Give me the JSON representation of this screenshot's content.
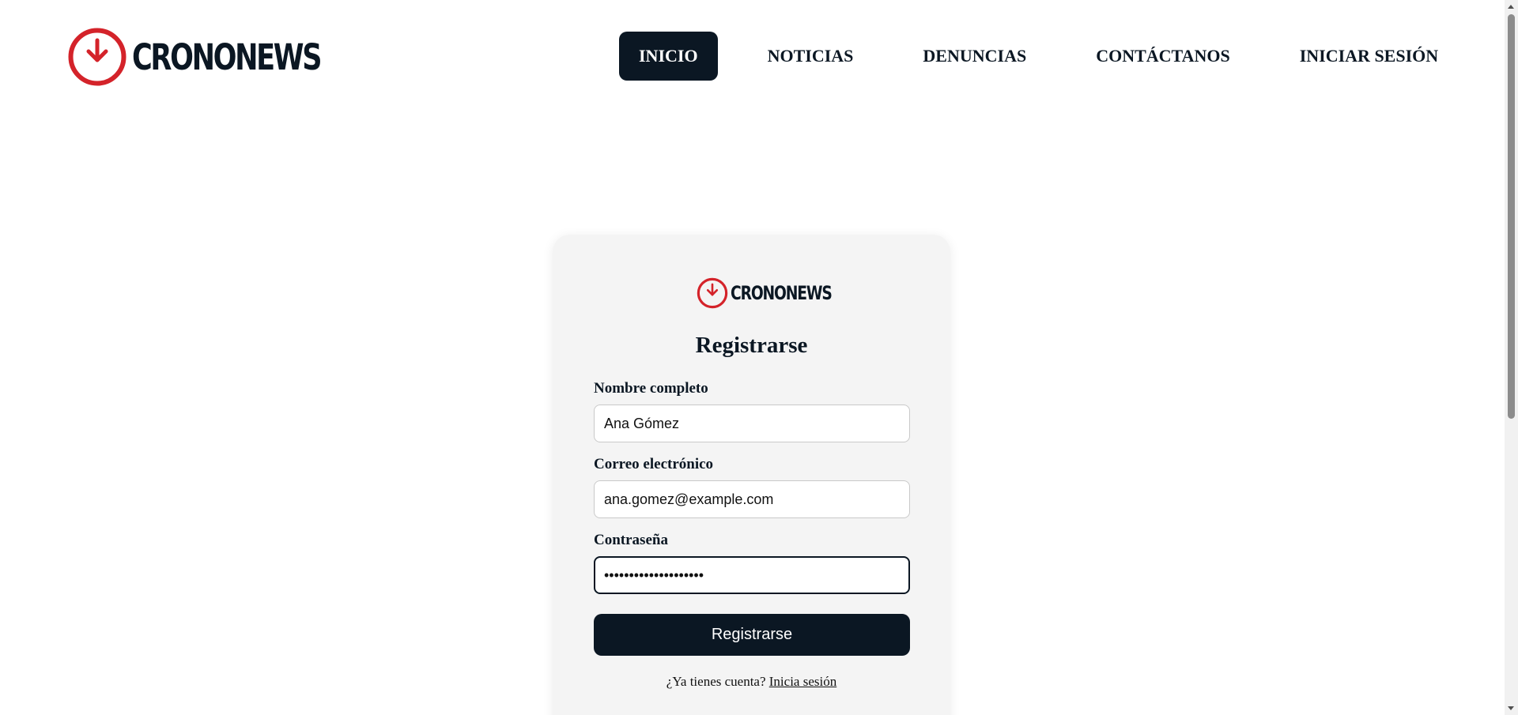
{
  "brand": {
    "name": "CRONONEWS",
    "accent_color": "#d4232a",
    "dark_color": "#0b1723"
  },
  "nav": {
    "items": [
      {
        "label": "INICIO",
        "active": true
      },
      {
        "label": "NOTICIAS",
        "active": false
      },
      {
        "label": "DENUNCIAS",
        "active": false
      },
      {
        "label": "CONTÁCTANOS",
        "active": false
      },
      {
        "label": "INICIAR SESIÓN",
        "active": false
      }
    ]
  },
  "register": {
    "title": "Registrarse",
    "fields": [
      {
        "label": "Nombre completo",
        "value": "Ana Gómez",
        "type": "text"
      },
      {
        "label": "Correo electrónico",
        "value": "ana.gomez@example.com",
        "type": "email"
      },
      {
        "label": "Contraseña",
        "value": "••••••••••••••••••••",
        "type": "password"
      }
    ],
    "submit_label": "Registrarse",
    "login_prompt": "¿Ya tienes cuenta?",
    "login_link": "Inicia sesión"
  },
  "icons": {
    "logo": "clock-arrow-down-icon"
  }
}
